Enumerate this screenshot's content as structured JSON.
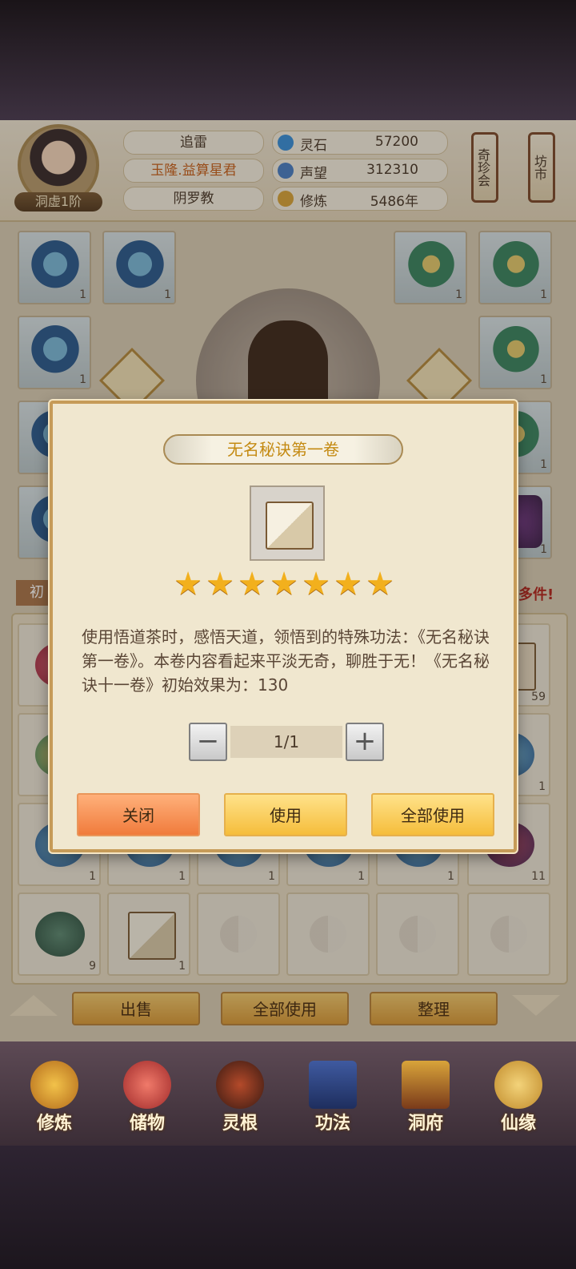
{
  "profile": {
    "name": "追雷",
    "title": "玉隆.益算星君",
    "sect": "阴罗教",
    "rank": "洞虚1阶"
  },
  "stats": [
    {
      "label": "灵石",
      "value": "57200",
      "icon": "spirit-stone-icon",
      "color": "#3a8fd9"
    },
    {
      "label": "声望",
      "value": "312310",
      "icon": "reputation-icon",
      "color": "#4a7fc4"
    },
    {
      "label": "修炼",
      "value": "5486年",
      "icon": "cultivation-icon",
      "color": "#d9a43a"
    }
  ],
  "side_buttons": {
    "treasure": "奇珍会",
    "market": "坊市"
  },
  "equipment_counts": [
    "1",
    "1",
    "1",
    "1",
    "1",
    "1",
    "1",
    "1",
    "1"
  ],
  "banner": {
    "left": "初",
    "right": "多件!"
  },
  "bag": {
    "visible_counts": [
      "59",
      "1",
      "1",
      "1",
      "1",
      "1",
      "1",
      "1",
      "11",
      "9",
      "1"
    ],
    "buttons": {
      "sell": "出售",
      "use_all": "全部使用",
      "sort": "整理"
    }
  },
  "nav": [
    {
      "label": "修炼",
      "icon": "cultivate-icon"
    },
    {
      "label": "储物",
      "icon": "storage-bag-icon"
    },
    {
      "label": "灵根",
      "icon": "spirit-root-icon"
    },
    {
      "label": "功法",
      "icon": "technique-book-icon"
    },
    {
      "label": "洞府",
      "icon": "cave-house-icon"
    },
    {
      "label": "仙缘",
      "icon": "fate-gourd-icon"
    }
  ],
  "modal": {
    "title": "无名秘诀第一卷",
    "stars": 7,
    "description": "使用悟道茶时，感悟天道，领悟到的特殊功法：《无名秘诀第一卷》。本卷内容看起来平淡无奇，聊胜于无！《无名秘诀十一卷》初始效果为：130",
    "quantity": "1/1",
    "minus": "−",
    "plus": "+",
    "buttons": {
      "close": "关闭",
      "use": "使用",
      "use_all": "全部使用"
    }
  }
}
